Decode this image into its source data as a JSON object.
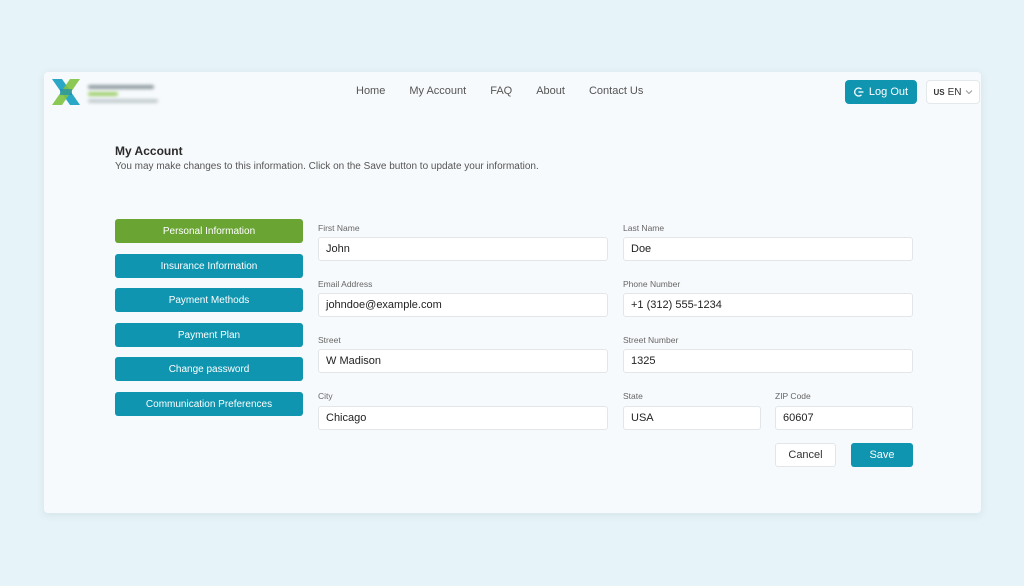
{
  "colors": {
    "accent": "#0f95b0",
    "active": "#6aa534",
    "background": "#e6f3f8"
  },
  "header": {
    "nav": [
      "Home",
      "My Account",
      "FAQ",
      "About",
      "Contact Us"
    ],
    "logout_label": "Log Out",
    "language": {
      "flag": "US",
      "code": "EN"
    }
  },
  "page": {
    "title": "My Account",
    "description": "You may make changes to this information. Click on the Save button to update your information."
  },
  "sidebar": {
    "items": [
      {
        "label": "Personal Information",
        "active": true
      },
      {
        "label": "Insurance Information",
        "active": false
      },
      {
        "label": "Payment Methods",
        "active": false
      },
      {
        "label": "Payment Plan",
        "active": false
      },
      {
        "label": "Change password",
        "active": false
      },
      {
        "label": "Communication Preferences",
        "active": false
      }
    ]
  },
  "form": {
    "first_name": {
      "label": "First Name",
      "value": "John"
    },
    "last_name": {
      "label": "Last Name",
      "value": "Doe"
    },
    "email": {
      "label": "Email Address",
      "value": "johndoe@example.com"
    },
    "phone": {
      "label": "Phone Number",
      "value": "+1 (312) 555-1234"
    },
    "street": {
      "label": "Street",
      "value": "W Madison"
    },
    "street_number": {
      "label": "Street Number",
      "value": "1325"
    },
    "city": {
      "label": "City",
      "value": "Chicago"
    },
    "state": {
      "label": "State",
      "value": "USA"
    },
    "zip": {
      "label": "ZIP Code",
      "value": "60607"
    },
    "cancel_label": "Cancel",
    "save_label": "Save"
  }
}
